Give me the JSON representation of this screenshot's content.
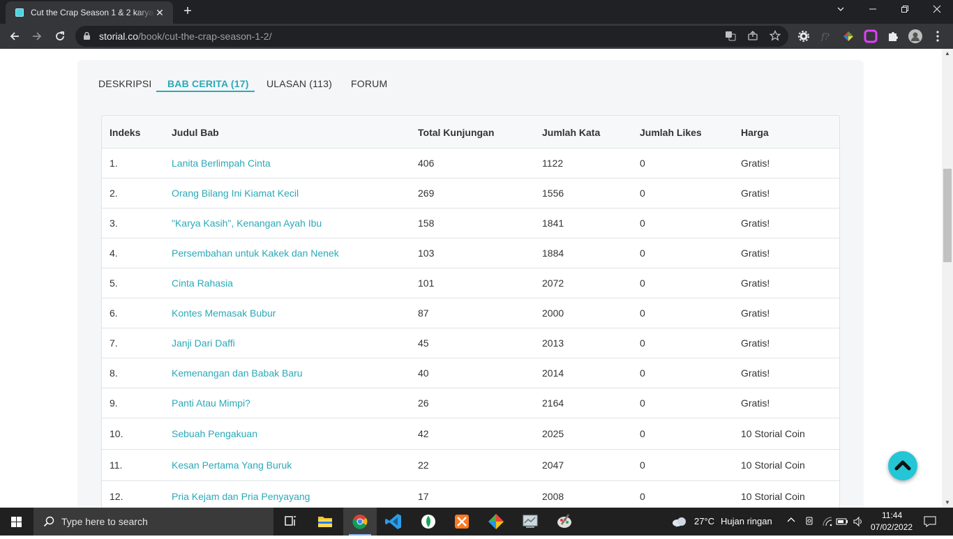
{
  "browser": {
    "tab_title": "Cut the Crap Season 1 & 2 karya",
    "tab_close": "✕",
    "new_tab": "+",
    "url_host": "storial.co",
    "url_path": "/book/cut-the-crap-season-1-2/"
  },
  "page_tabs": [
    {
      "label": "DESKRIPSI",
      "active": false
    },
    {
      "label": "BAB CERITA (17)",
      "active": true
    },
    {
      "label": "ULASAN (113)",
      "active": false
    },
    {
      "label": "FORUM",
      "active": false
    }
  ],
  "table": {
    "headers": [
      "Indeks",
      "Judul Bab",
      "Total Kunjungan",
      "Jumlah Kata",
      "Jumlah Likes",
      "Harga"
    ],
    "rows": [
      {
        "index": "1.",
        "title": "Lanita Berlimpah Cinta",
        "visits": "406",
        "words": "1122",
        "likes": "0",
        "price": "Gratis!"
      },
      {
        "index": "2.",
        "title": "Orang Bilang Ini Kiamat Kecil",
        "visits": "269",
        "words": "1556",
        "likes": "0",
        "price": "Gratis!"
      },
      {
        "index": "3.",
        "title": "\"Karya Kasih\", Kenangan Ayah Ibu",
        "visits": "158",
        "words": "1841",
        "likes": "0",
        "price": "Gratis!"
      },
      {
        "index": "4.",
        "title": "Persembahan untuk Kakek dan Nenek",
        "visits": "103",
        "words": "1884",
        "likes": "0",
        "price": "Gratis!"
      },
      {
        "index": "5.",
        "title": "Cinta Rahasia",
        "visits": "101",
        "words": "2072",
        "likes": "0",
        "price": "Gratis!"
      },
      {
        "index": "6.",
        "title": "Kontes Memasak Bubur",
        "visits": "87",
        "words": "2000",
        "likes": "0",
        "price": "Gratis!"
      },
      {
        "index": "7.",
        "title": "Janji Dari Daffi",
        "visits": "45",
        "words": "2013",
        "likes": "0",
        "price": "Gratis!"
      },
      {
        "index": "8.",
        "title": "Kemenangan dan Babak Baru",
        "visits": "40",
        "words": "2014",
        "likes": "0",
        "price": "Gratis!"
      },
      {
        "index": "9.",
        "title": "Panti Atau Mimpi?",
        "visits": "26",
        "words": "2164",
        "likes": "0",
        "price": "Gratis!"
      },
      {
        "index": "10.",
        "title": "Sebuah Pengakuan",
        "visits": "42",
        "words": "2025",
        "likes": "0",
        "price": "10 Storial Coin"
      },
      {
        "index": "11.",
        "title": "Kesan Pertama Yang Buruk",
        "visits": "22",
        "words": "2047",
        "likes": "0",
        "price": "10 Storial Coin"
      },
      {
        "index": "12.",
        "title": "Pria Kejam dan Pria Penyayang",
        "visits": "17",
        "words": "2008",
        "likes": "0",
        "price": "10 Storial Coin"
      }
    ]
  },
  "taskbar": {
    "search_placeholder": "Type here to search",
    "weather_temp": "27°C",
    "weather_desc": "Hujan ringan",
    "time": "11:44",
    "date": "07/02/2022"
  },
  "colors": {
    "accent": "#2aa9b8",
    "fab": "#24c6d6"
  }
}
